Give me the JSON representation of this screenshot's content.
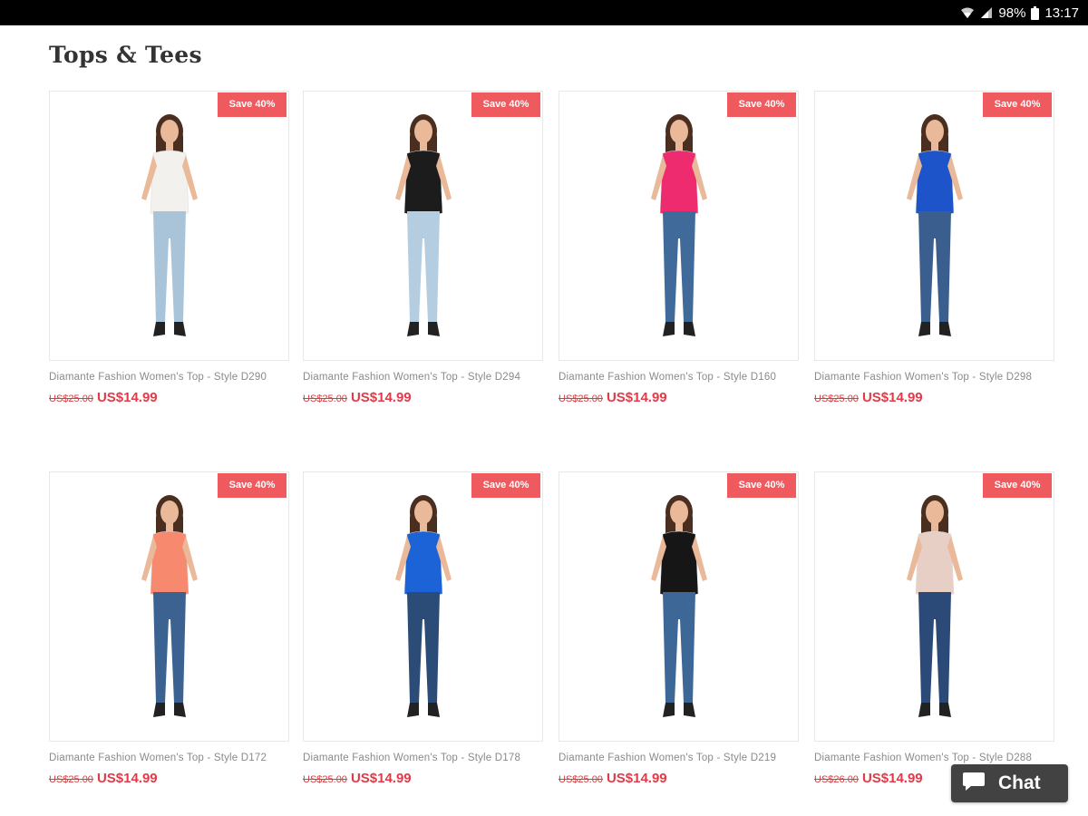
{
  "status_bar": {
    "battery_percent": "98%",
    "time": "13:17"
  },
  "page": {
    "title": "Tops & Tees"
  },
  "products": [
    {
      "title": "Diamante Fashion Women's Top - Style D290",
      "old_price": "US$25.00",
      "new_price": "US$14.99",
      "badge": "Save 40%",
      "top_color": "#f2f1ee",
      "jeans_color": "#a9c3d8",
      "icon": "white-ruffle-top"
    },
    {
      "title": "Diamante Fashion Women's Top - Style D294",
      "old_price": "US$25.00",
      "new_price": "US$14.99",
      "badge": "Save 40%",
      "top_color": "#1c1c1c",
      "jeans_color": "#b4cde0",
      "icon": "black-lace-top"
    },
    {
      "title": "Diamante Fashion Women's Top - Style D160",
      "old_price": "US$25.00",
      "new_price": "US$14.99",
      "badge": "Save 40%",
      "top_color": "#ee2b6e",
      "jeans_color": "#3f6a9a",
      "icon": "pink-cami-top"
    },
    {
      "title": "Diamante Fashion Women's Top - Style D298",
      "old_price": "US$25.00",
      "new_price": "US$14.99",
      "badge": "Save 40%",
      "top_color": "#1d54c9",
      "jeans_color": "#3a5f8f",
      "icon": "blue-lace-top"
    },
    {
      "title": "Diamante Fashion Women's Top - Style D172",
      "old_price": "US$25.00",
      "new_price": "US$14.99",
      "badge": "Save 40%",
      "top_color": "#f78a6e",
      "jeans_color": "#3b6291",
      "icon": "coral-tunic-top"
    },
    {
      "title": "Diamante Fashion Women's Top - Style D178",
      "old_price": "US$25.00",
      "new_price": "US$14.99",
      "badge": "Save 40%",
      "top_color": "#1b63d6",
      "jeans_color": "#2c4c78",
      "icon": "blue-off-shoulder-top"
    },
    {
      "title": "Diamante Fashion Women's Top - Style D219",
      "old_price": "US$25.00",
      "new_price": "US$14.99",
      "badge": "Save 40%",
      "top_color": "#161616",
      "jeans_color": "#3d6797",
      "icon": "black-tee-top"
    },
    {
      "title": "Diamante Fashion Women's Top - Style D288",
      "old_price": "US$26.00",
      "new_price": "US$14.99",
      "badge": "Save 40%",
      "top_color": "#e8cfc6",
      "jeans_color": "#2b4a78",
      "icon": "blush-wrap-top"
    }
  ],
  "chat": {
    "label": "Chat",
    "icon": "chat-bubble-icon"
  },
  "colors": {
    "sale_red": "#ee5a5e",
    "price_red": "#e23a48",
    "status_bar": "#000000",
    "chat_bg": "#424242"
  }
}
